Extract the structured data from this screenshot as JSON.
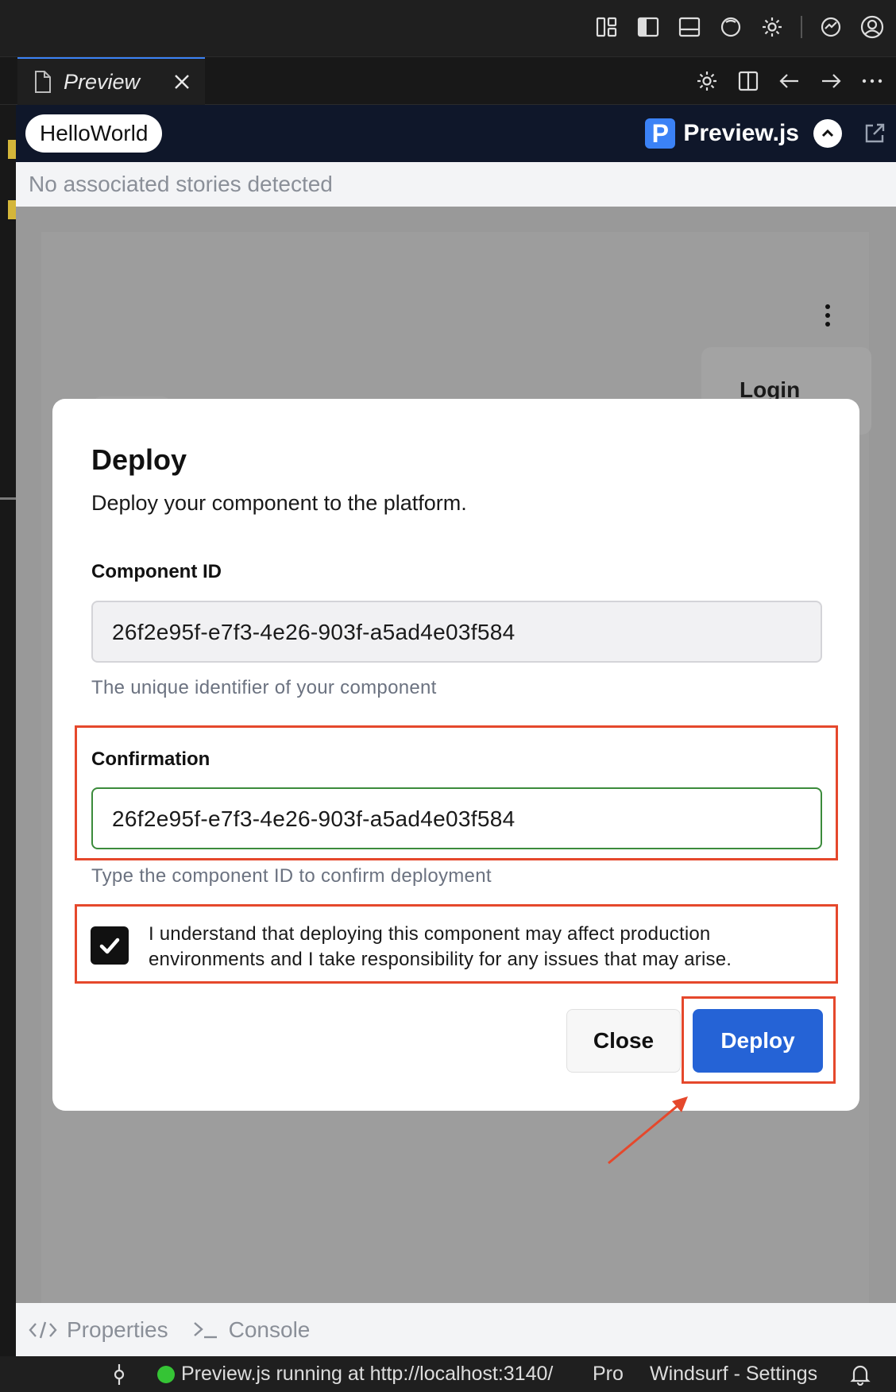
{
  "tab": {
    "label": "Preview"
  },
  "preview_header": {
    "component_pill": "HelloWorld",
    "brand_letter": "P",
    "brand_name": "Preview.js"
  },
  "stories_message": "No associated stories detected",
  "background": {
    "login_label": "Login"
  },
  "dialog": {
    "title": "Deploy",
    "subtitle": "Deploy your component to the platform.",
    "component_id_label": "Component ID",
    "component_id_value": "26f2e95f-e7f3-4e26-903f-a5ad4e03f584",
    "component_id_help": "The unique identifier of your component",
    "confirmation_label": "Confirmation",
    "confirmation_value": "26f2e95f-e7f3-4e26-903f-a5ad4e03f584",
    "confirmation_help": "Type the component ID to confirm deployment",
    "checkbox_checked": true,
    "checkbox_line1": "I understand that deploying this component may affect production",
    "checkbox_line2": "environments and I take responsibility for any issues that may arise.",
    "close_label": "Close",
    "deploy_label": "Deploy"
  },
  "panel_tabs": [
    {
      "label": "Properties",
      "icon": "code-icon"
    },
    {
      "label": "Console",
      "icon": "terminal-icon"
    }
  ],
  "status_bar": {
    "running": "Preview.js running at http://localhost:3140/",
    "plan": "Pro",
    "settings": "Windsurf - Settings"
  },
  "colors": {
    "accent": "#2563d6",
    "highlight": "#e5482c",
    "valid_border": "#3b8b3b"
  }
}
